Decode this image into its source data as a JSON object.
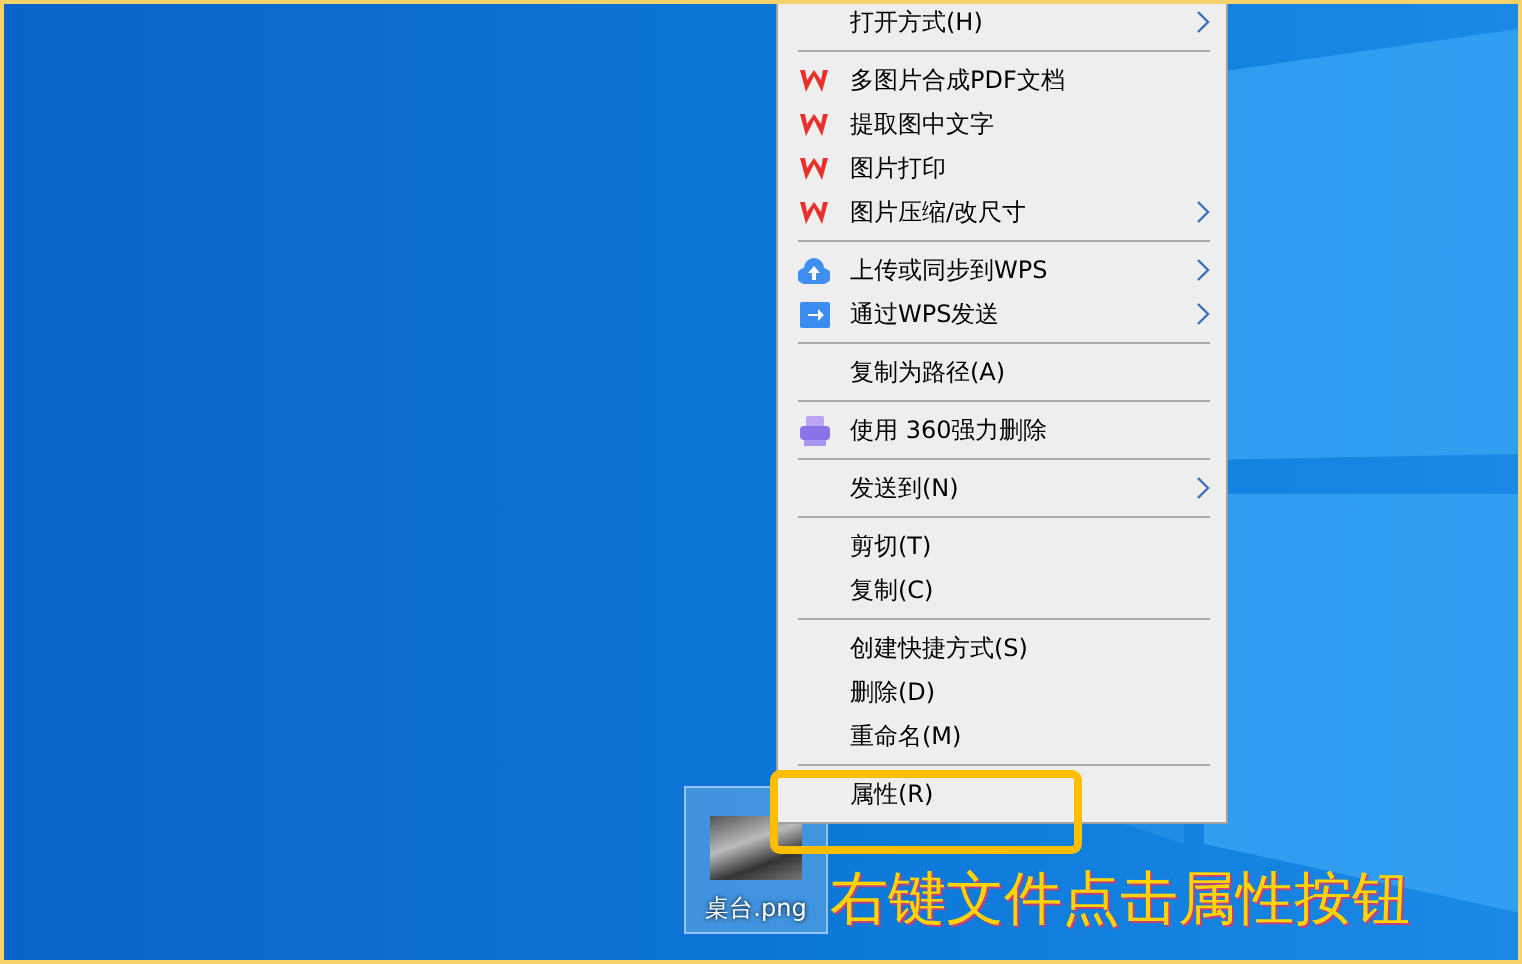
{
  "context_menu": {
    "entries": [
      {
        "kind": "plain",
        "label": "打开方式(H)",
        "submenu": true
      },
      {
        "kind": "separator"
      },
      {
        "kind": "wps",
        "label": "多图片合成PDF文档",
        "submenu": false
      },
      {
        "kind": "wps",
        "label": "提取图中文字",
        "submenu": false
      },
      {
        "kind": "wps",
        "label": "图片打印",
        "submenu": false
      },
      {
        "kind": "wps",
        "label": "图片压缩/改尺寸",
        "submenu": true
      },
      {
        "kind": "separator"
      },
      {
        "kind": "cloud",
        "label": "上传或同步到WPS",
        "submenu": true
      },
      {
        "kind": "send",
        "label": "通过WPS发送",
        "submenu": true
      },
      {
        "kind": "separator"
      },
      {
        "kind": "plain",
        "label": "复制为路径(A)",
        "submenu": false
      },
      {
        "kind": "separator"
      },
      {
        "kind": "shredder",
        "label": "使用 360强力删除",
        "submenu": false
      },
      {
        "kind": "separator"
      },
      {
        "kind": "plain",
        "label": "发送到(N)",
        "submenu": true
      },
      {
        "kind": "separator"
      },
      {
        "kind": "plain",
        "label": "剪切(T)",
        "submenu": false
      },
      {
        "kind": "plain",
        "label": "复制(C)",
        "submenu": false
      },
      {
        "kind": "separator"
      },
      {
        "kind": "plain",
        "label": "创建快捷方式(S)",
        "submenu": false
      },
      {
        "kind": "plain",
        "label": "删除(D)",
        "submenu": false
      },
      {
        "kind": "plain",
        "label": "重命名(M)",
        "submenu": false
      },
      {
        "kind": "separator"
      },
      {
        "kind": "plain",
        "label": "属性(R)",
        "submenu": false
      }
    ]
  },
  "desktop_icon": {
    "label": "桌台.png",
    "selected": true
  },
  "caption": "右键文件点击属性按钮"
}
